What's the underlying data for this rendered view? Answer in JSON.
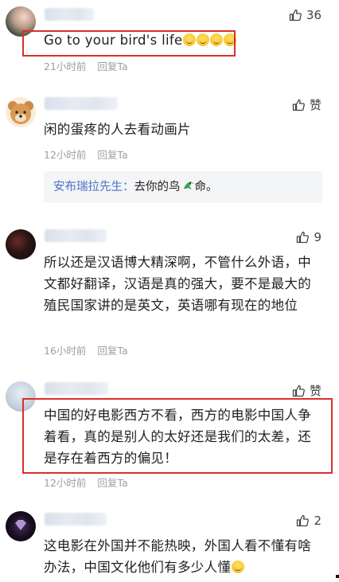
{
  "comments": [
    {
      "name_suffix": "",
      "likes": "36",
      "text": "Go to your bird's life",
      "time": "21小时前",
      "reply_label": "回复Ta"
    },
    {
      "likes": "赞",
      "text": "闲的蛋疼的人去看动画片",
      "time": "12小时前",
      "reply_label": "回复Ta",
      "sub_reply": {
        "author": "安布瑞拉先生：",
        "content_before": "去你的鸟",
        "content_after": "命。"
      }
    },
    {
      "likes": "9",
      "text": "所以还是汉语博大精深啊，不管什么外语，中文都好翻译，汉语是真的强大，要不是最大的殖民国家讲的是英文，英语哪有现在的地位",
      "time": "16小时前",
      "reply_label": "回复Ta"
    },
    {
      "likes": "赞",
      "text": "中国的好电影西方不看，西方的电影中国人争着看，真的是别人的太好还是我们的太差，还是存在着西方的偏见！",
      "time": "12小时前",
      "reply_label": "回复Ta"
    },
    {
      "likes": "2",
      "text": "这电影在外国并不能热映，外国人看不懂有啥办法，中国文化他们有多少人懂",
      "time": "",
      "reply_label": ""
    }
  ],
  "colors": {
    "highlight": "#d9302c",
    "author_link": "#4a72c4",
    "meta": "#9aa0a6"
  }
}
